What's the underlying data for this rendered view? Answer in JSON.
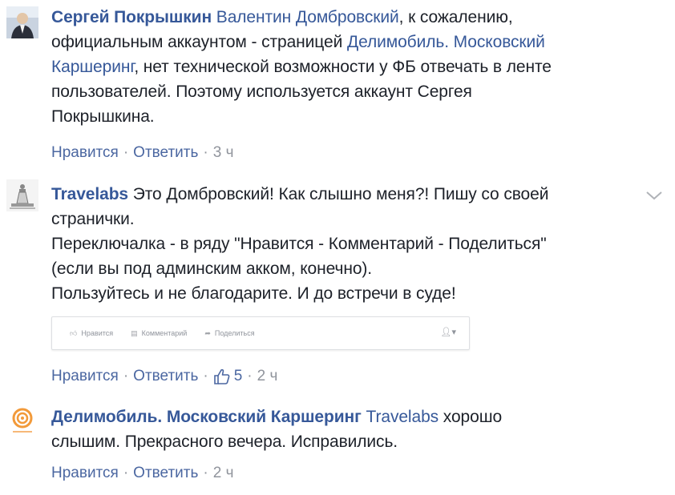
{
  "comments": [
    {
      "author": "Сергей Покрышкин",
      "mention": "Валентин Домбровский",
      "lines": [
        ", к сожалению,",
        "официальным аккаунтом - страницей ",
        "Делимобиль. Московский",
        "Каршеринг",
        ", нет технической возможности у ФБ отвечать в ленте",
        "пользователей. Поэтому используется аккаунт Сергея",
        "Покрышкина."
      ],
      "actions": {
        "like": "Нравится",
        "reply": "Ответить",
        "time": "3 ч"
      }
    },
    {
      "author": "Travelabs",
      "lines": [
        "Это Домбровский! Как слышно меня?! Пишу со своей",
        "странички.",
        "Переключалка - в ряду \"Нравится - Комментарий - Поделиться\"",
        "(если вы под админским акком, конечно).",
        "Пользуйтесь и не благодарите. И до встречи в суде!"
      ],
      "embed": {
        "like": "Нравится",
        "comment": "Комментарий",
        "share": "Поделиться"
      },
      "actions": {
        "like": "Нравится",
        "reply": "Ответить",
        "likes_count": "5",
        "time": "2 ч"
      }
    },
    {
      "author": "Делимобиль. Московский Каршеринг",
      "mention": "Travelabs",
      "lines": [
        " хорошо",
        "слышим. Прекрасного вечера. Исправились."
      ],
      "actions": {
        "like": "Нравится",
        "reply": "Ответить",
        "time": "2 ч"
      }
    }
  ],
  "colors": {
    "link": "#365899",
    "meta": "#90949c",
    "text": "#1d2129"
  }
}
